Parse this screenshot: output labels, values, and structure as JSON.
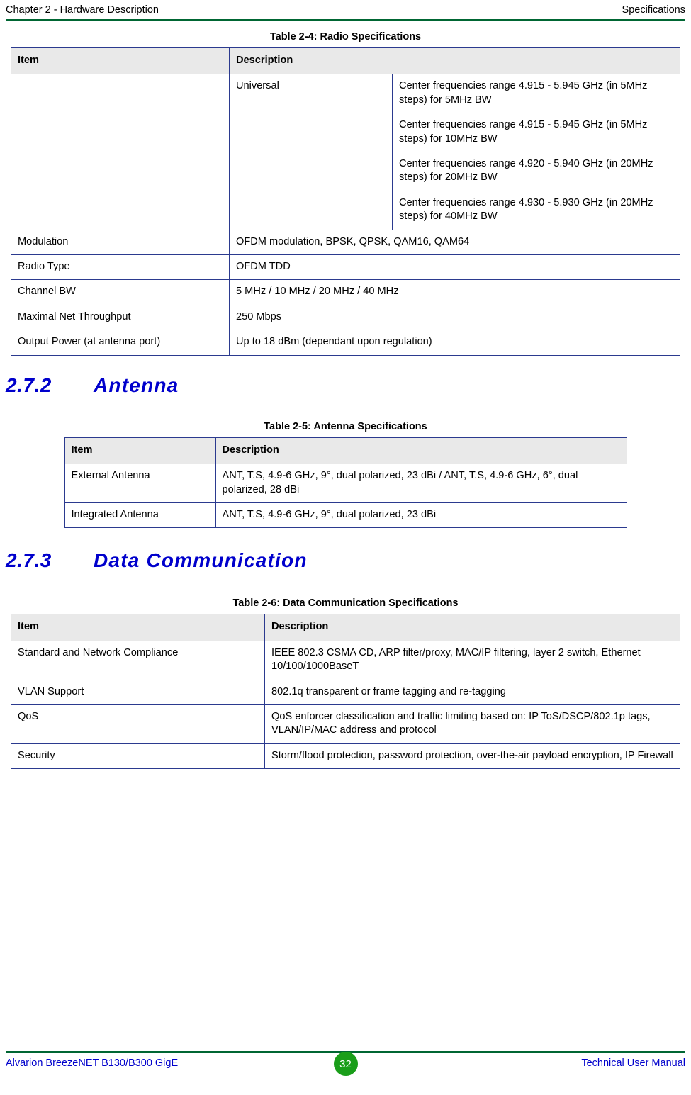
{
  "header": {
    "left": "Chapter 2 - Hardware Description",
    "right": "Specifications"
  },
  "table_2_4": {
    "caption": "Table 2-4: Radio Specifications",
    "headers": [
      "Item",
      "Description"
    ],
    "universal_label": "Universal",
    "universal_rows": [
      "Center frequencies range 4.915 - 5.945 GHz (in 5MHz steps) for 5MHz BW",
      "Center frequencies range 4.915 - 5.945 GHz (in 5MHz steps) for 10MHz BW",
      "Center frequencies range 4.920 - 5.940 GHz (in 20MHz steps) for 20MHz BW",
      "Center frequencies range 4.930 - 5.930 GHz (in 20MHz steps) for 40MHz BW"
    ],
    "rows": [
      {
        "item": "Modulation",
        "description": "OFDM modulation, BPSK, QPSK, QAM16, QAM64"
      },
      {
        "item": "Radio Type",
        "description": "OFDM TDD"
      },
      {
        "item": "Channel BW",
        "description": "5 MHz / 10 MHz / 20 MHz / 40 MHz"
      },
      {
        "item": "Maximal Net Throughput",
        "description": "250 Mbps"
      },
      {
        "item": "Output Power (at antenna port)",
        "description": "Up to 18 dBm (dependant upon regulation)"
      }
    ]
  },
  "section_272": {
    "number": "2.7.2",
    "title": "Antenna"
  },
  "table_2_5": {
    "caption": "Table 2-5: Antenna Specifications",
    "headers": [
      "Item",
      "Description"
    ],
    "rows": [
      {
        "item": "External Antenna",
        "description": "ANT, T.S, 4.9-6 GHz, 9°, dual polarized, 23 dBi / ANT, T.S, 4.9-6 GHz, 6°, dual polarized, 28 dBi"
      },
      {
        "item": "Integrated Antenna",
        "description": "ANT, T.S, 4.9-6 GHz, 9°, dual polarized, 23 dBi"
      }
    ]
  },
  "section_273": {
    "number": "2.7.3",
    "title": "Data Communication"
  },
  "table_2_6": {
    "caption": "Table 2-6: Data Communication Specifications",
    "headers": [
      "Item",
      "Description"
    ],
    "rows": [
      {
        "item": "Standard and Network Compliance",
        "description": "IEEE 802.3 CSMA CD, ARP filter/proxy, MAC/IP filtering, layer 2 switch, Ethernet 10/100/1000BaseT"
      },
      {
        "item": "VLAN Support",
        "description": "802.1q transparent or frame tagging and re-tagging"
      },
      {
        "item": "QoS",
        "description": "QoS enforcer classification and traffic limiting based on: IP ToS/DSCP/802.1p tags, VLAN/IP/MAC address and protocol"
      },
      {
        "item": "Security",
        "description": "Storm/flood protection, password protection, over-the-air payload encryption, IP Firewall"
      }
    ]
  },
  "footer": {
    "left": "Alvarion BreezeNET B130/B300 GigE",
    "page": "32",
    "right": "Technical User Manual"
  }
}
